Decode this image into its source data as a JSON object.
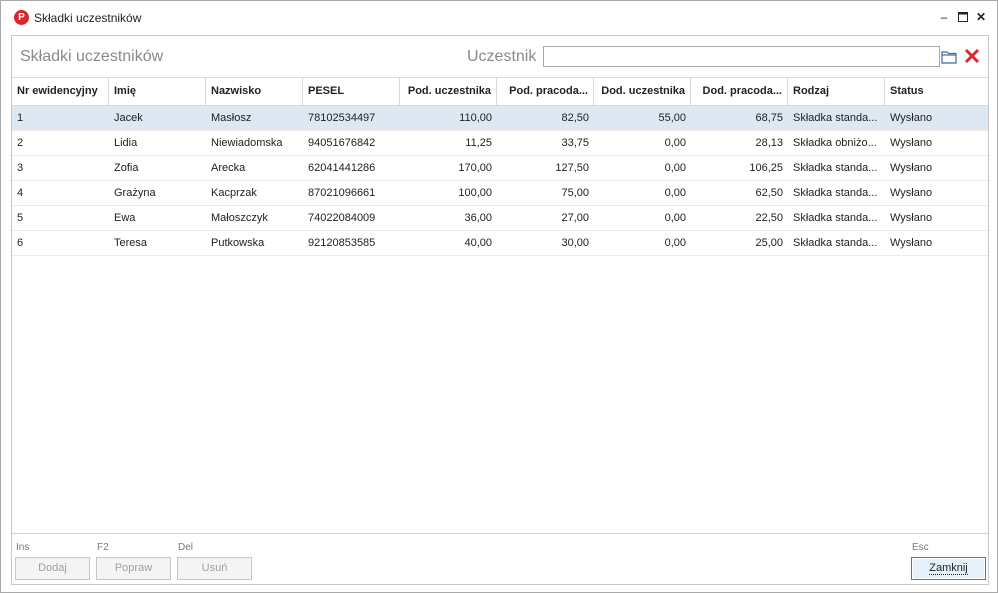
{
  "window": {
    "title": "Składki uczestników"
  },
  "panel": {
    "title": "Składki uczestników",
    "search_label": "Uczestnik",
    "search_value": ""
  },
  "columns": [
    "Nr ewidencyjny",
    "Imię",
    "Nazwisko",
    "PESEL",
    "Pod. uczestnika",
    "Pod. pracoda...",
    "Dod. uczestnika",
    "Dod. pracoda...",
    "Rodzaj",
    "Status"
  ],
  "rows": [
    {
      "nr": "1",
      "imie": "Jacek",
      "nazwisko": "Masłosz",
      "pesel": "78102534497",
      "pod_u": "110,00",
      "pod_p": "82,50",
      "dod_u": "55,00",
      "dod_p": "68,75",
      "rodzaj": "Składka standa...",
      "status": "Wysłano",
      "selected": true
    },
    {
      "nr": "2",
      "imie": "Lidia",
      "nazwisko": "Niewiadomska",
      "pesel": "94051676842",
      "pod_u": "11,25",
      "pod_p": "33,75",
      "dod_u": "0,00",
      "dod_p": "28,13",
      "rodzaj": "Składka obniżo...",
      "status": "Wysłano",
      "selected": false
    },
    {
      "nr": "3",
      "imie": "Zofia",
      "nazwisko": "Arecka",
      "pesel": "62041441286",
      "pod_u": "170,00",
      "pod_p": "127,50",
      "dod_u": "0,00",
      "dod_p": "106,25",
      "rodzaj": "Składka standa...",
      "status": "Wysłano",
      "selected": false
    },
    {
      "nr": "4",
      "imie": "Grażyna",
      "nazwisko": "Kacprzak",
      "pesel": "87021096661",
      "pod_u": "100,00",
      "pod_p": "75,00",
      "dod_u": "0,00",
      "dod_p": "62,50",
      "rodzaj": "Składka standa...",
      "status": "Wysłano",
      "selected": false
    },
    {
      "nr": "5",
      "imie": "Ewa",
      "nazwisko": "Małoszczyk",
      "pesel": "74022084009",
      "pod_u": "36,00",
      "pod_p": "27,00",
      "dod_u": "0,00",
      "dod_p": "22,50",
      "rodzaj": "Składka standa...",
      "status": "Wysłano",
      "selected": false
    },
    {
      "nr": "6",
      "imie": "Teresa",
      "nazwisko": "Putkowska",
      "pesel": "92120853585",
      "pod_u": "40,00",
      "pod_p": "30,00",
      "dod_u": "0,00",
      "dod_p": "25,00",
      "rodzaj": "Składka standa...",
      "status": "Wysłano",
      "selected": false
    }
  ],
  "footer": {
    "add": {
      "shortcut": "Ins",
      "label": "Dodaj"
    },
    "edit": {
      "shortcut": "F2",
      "label": "Popraw"
    },
    "delete": {
      "shortcut": "Del",
      "label": "Usuń"
    },
    "close": {
      "shortcut": "Esc",
      "label": "Zamknij"
    }
  },
  "colors": {
    "accent_red": "#d9272e",
    "selection": "#dde8f3"
  }
}
